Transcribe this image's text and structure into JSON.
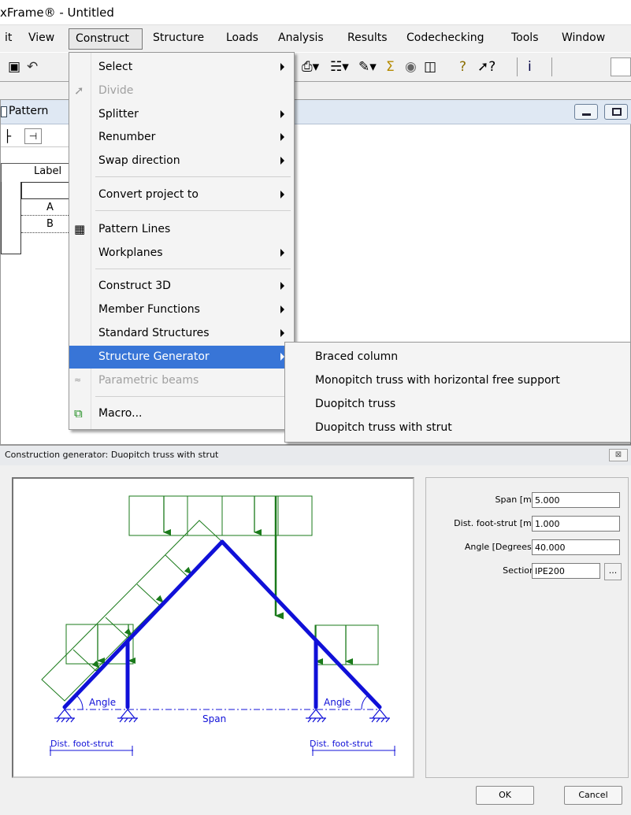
{
  "window_title": "xFrame® - Untitled",
  "menubar": {
    "items": [
      "it",
      "View",
      "Construct",
      "Structure",
      "Loads",
      "Analysis",
      "Results",
      "Codechecking",
      "Tools",
      "Window"
    ]
  },
  "pattern_window": {
    "title": "Pattern",
    "table": {
      "header": "Label",
      "rows": [
        "A",
        "B"
      ]
    }
  },
  "construct_menu": {
    "items": [
      {
        "label": "Select",
        "submenu": true,
        "disabled": false
      },
      {
        "label": "Divide",
        "submenu": false,
        "disabled": true
      },
      {
        "label": "Splitter",
        "submenu": true,
        "disabled": false
      },
      {
        "label": "Renumber",
        "submenu": true,
        "disabled": false
      },
      {
        "label": "Swap direction",
        "submenu": true,
        "disabled": false
      },
      {
        "label": "Convert project to",
        "submenu": true,
        "disabled": false
      },
      {
        "label": "Pattern Lines",
        "submenu": false,
        "disabled": false
      },
      {
        "label": "Workplanes",
        "submenu": true,
        "disabled": false
      },
      {
        "label": "Construct 3D",
        "submenu": true,
        "disabled": false
      },
      {
        "label": "Member Functions",
        "submenu": true,
        "disabled": false
      },
      {
        "label": "Standard Structures",
        "submenu": true,
        "disabled": false
      },
      {
        "label": "Structure Generator",
        "submenu": true,
        "disabled": false,
        "highlighted": true
      },
      {
        "label": "Parametric beams",
        "submenu": false,
        "disabled": true
      },
      {
        "label": "Macro...",
        "submenu": false,
        "disabled": false
      }
    ]
  },
  "structure_generator_submenu": {
    "items": [
      "Braced column",
      "Monopitch truss with horizontal free support",
      "Duopitch truss",
      "Duopitch truss with strut"
    ]
  },
  "dialog": {
    "title": "Construction generator: Duopitch truss with strut",
    "close_glyph": "⊠",
    "diagram": {
      "angle_label": "Angle",
      "span_label": "Span",
      "dist_label": "Dist. foot-strut"
    },
    "fields": [
      {
        "label": "Span [m]",
        "value": "5.000"
      },
      {
        "label": "Dist. foot-strut [m]",
        "value": "1.000"
      },
      {
        "label": "Angle [Degrees]",
        "value": "40.000"
      },
      {
        "label": "Section",
        "value": "IPE200"
      }
    ],
    "section_browse": "...",
    "ok_label": "OK",
    "cancel_label": "Cancel"
  },
  "colors": {
    "member_blue": "#1010d8",
    "load_green": "#1a7a1a",
    "highlight": "#3875d7"
  }
}
